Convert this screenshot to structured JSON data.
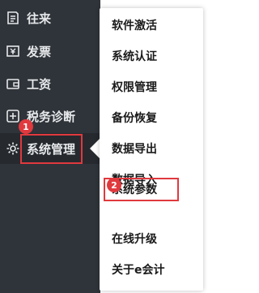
{
  "sidebar": {
    "items": [
      {
        "label": "往来",
        "icon": "contacts-icon"
      },
      {
        "label": "发票",
        "icon": "invoice-icon"
      },
      {
        "label": "工资",
        "icon": "wallet-icon"
      },
      {
        "label": "税务诊断",
        "icon": "tax-diagnosis-icon"
      },
      {
        "label": "系统管理",
        "icon": "gear-icon"
      }
    ]
  },
  "dropdown": {
    "items": [
      "软件激活",
      "系统认证",
      "权限管理",
      "备份恢复",
      "数据导出",
      "数据导入",
      "系统参数",
      "在线升级",
      "关于e会计"
    ]
  },
  "annotations": {
    "step1": "1",
    "step2": "2",
    "highlight_color": "#e0393e"
  }
}
